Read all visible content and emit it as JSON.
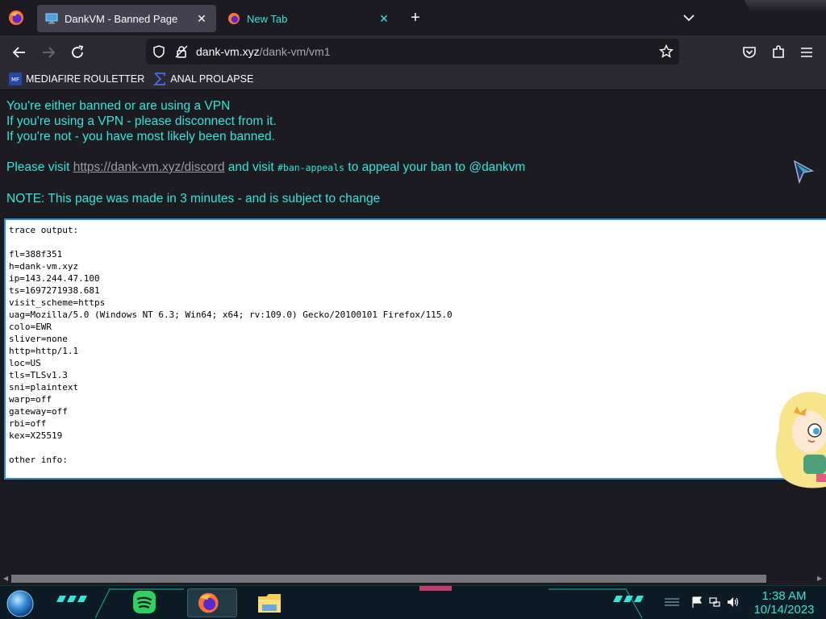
{
  "browser": {
    "tabs": [
      {
        "title": "DankVM - Banned Page",
        "active": true
      },
      {
        "title": "New Tab",
        "active": false
      }
    ],
    "url": {
      "host": "dank-vm.xyz",
      "path": "/dank-vm/vm1"
    },
    "bookmarks": [
      {
        "label": "MEDIAFIRE ROULETTER"
      },
      {
        "label": "ANAL PROLAPSE"
      }
    ]
  },
  "page": {
    "lines": [
      "You're either banned or are using a VPN",
      "If you're using a VPN - please disconnect from it.",
      "If you're not - you have most likely been banned."
    ],
    "visit": {
      "prefix": "Please visit ",
      "link": "https://dank-vm.xyz/discord",
      "middle": " and visit ",
      "channel": "#ban-appeals",
      "suffix": " to appeal your ban to @dankvm"
    },
    "note": "NOTE: This page was made in 3 minutes - and is subject to change",
    "trace_text": "trace output:\n\nfl=388f351\nh=dank-vm.xyz\nip=143.244.47.100\nts=1697271938.681\nvisit_scheme=https\nuag=Mozilla/5.0 (Windows NT 6.3; Win64; x64; rv:109.0) Gecko/20100101 Firefox/115.0\ncolo=EWR\nsliver=none\nhttp=http/1.1\nloc=US\ntls=TLSv1.3\nsni=plaintext\nwarp=off\ngateway=off\nrbi=off\nkex=X25519\n\nother info:"
  },
  "taskbar": {
    "time": "1:38 AM",
    "date": "10/14/2023"
  },
  "colors": {
    "accent": "#35e4d8",
    "background": "#1c1b22",
    "toolbar": "#2b2a33",
    "trace_border": "#2a8fd6"
  }
}
